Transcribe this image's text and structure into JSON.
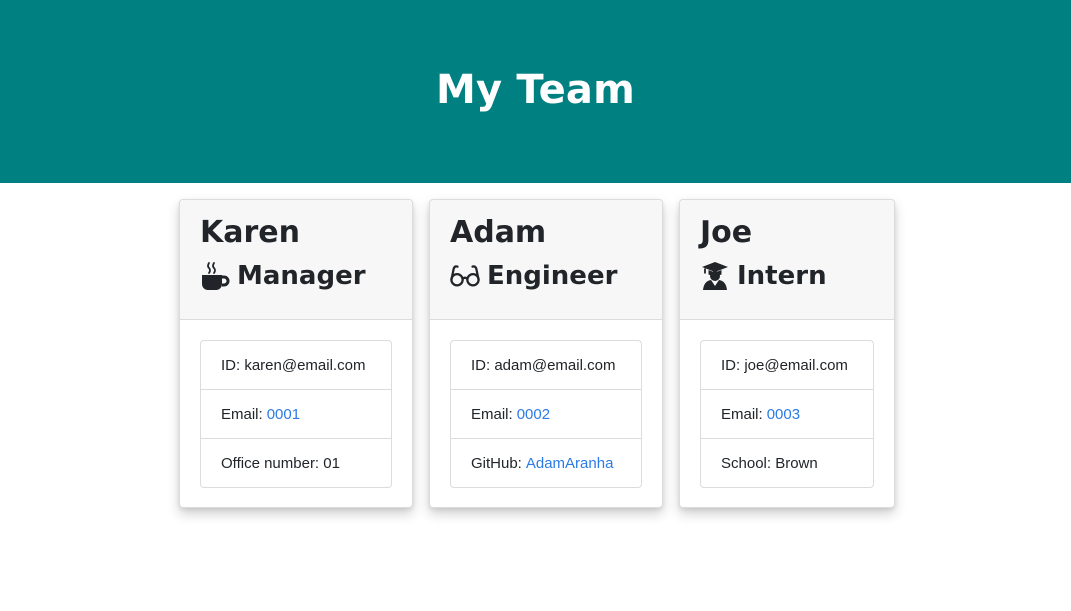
{
  "header": {
    "title": "My Team"
  },
  "cards": [
    {
      "name": "Karen",
      "role": "Manager",
      "role_icon": "coffee-mug-icon",
      "id_label": "ID: karen@email.com",
      "email_label": "Email:",
      "email_value": "0001",
      "extra_label": "Office number: 01",
      "extra_link": ""
    },
    {
      "name": "Adam",
      "role": "Engineer",
      "role_icon": "glasses-icon",
      "id_label": "ID: adam@email.com",
      "email_label": "Email:",
      "email_value": "0002",
      "extra_label": "GitHub:",
      "extra_link": "AdamAranha"
    },
    {
      "name": "Joe",
      "role": "Intern",
      "role_icon": "graduate-icon",
      "id_label": "ID: joe@email.com",
      "email_label": "Email:",
      "email_value": "0003",
      "extra_label": "School: Brown",
      "extra_link": ""
    }
  ],
  "colors": {
    "header_bg": "#008080",
    "link": "#2c7be5",
    "card_header_bg": "#f7f7f7"
  }
}
